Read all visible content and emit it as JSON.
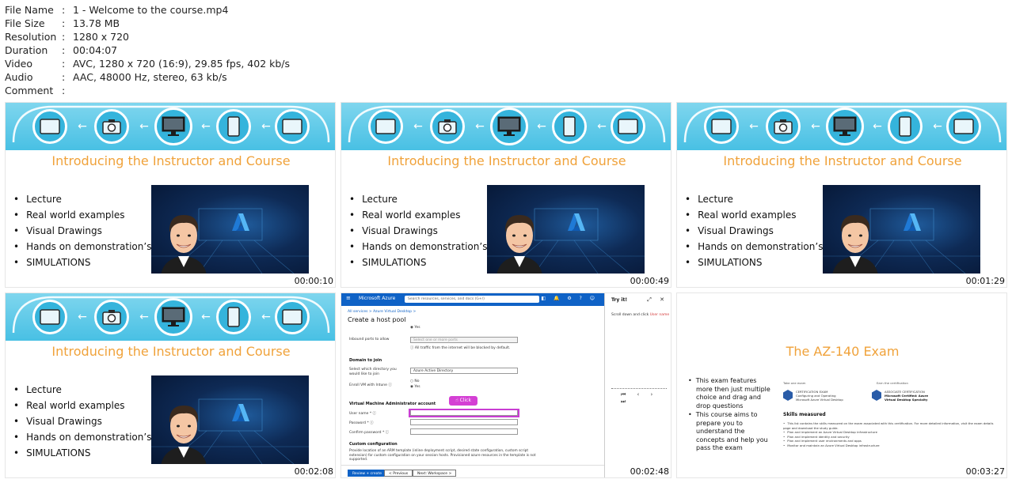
{
  "file_info": {
    "rows": [
      {
        "key": "File Name",
        "value": "1 - Welcome to the course.mp4"
      },
      {
        "key": "File Size",
        "value": "13.78 MB"
      },
      {
        "key": "Resolution",
        "value": "1280 x 720"
      },
      {
        "key": "Duration",
        "value": "00:04:07"
      },
      {
        "key": "Video",
        "value": "AVC, 1280 x 720 (16:9), 29.85 fps, 402 kb/s"
      },
      {
        "key": "Audio",
        "value": "AAC, 48000 Hz, stereo, 63 kb/s"
      },
      {
        "key": "Comment",
        "value": ""
      }
    ],
    "separator": ":"
  },
  "colors": {
    "banner": "#48c0e4",
    "title_orange": "#f0a23a",
    "azure_blue": "#0f62c6",
    "click_magenta": "#d43fd4"
  },
  "slide_intro": {
    "title": "Introducing the Instructor and Course",
    "bullets": [
      "Lecture",
      "Real world examples",
      "Visual Drawings",
      "Hands on demonstration’s",
      "SIMULATIONS"
    ],
    "icons": [
      "tablet-icon",
      "camera-icon",
      "monitor-icon",
      "phone-icon",
      "tablet-icon"
    ]
  },
  "thumbnails": [
    {
      "timestamp": "00:00:10"
    },
    {
      "timestamp": "00:00:49"
    },
    {
      "timestamp": "00:01:29"
    },
    {
      "timestamp": "00:02:08"
    },
    {
      "timestamp": "00:02:48"
    },
    {
      "timestamp": "00:03:27"
    }
  ],
  "azure": {
    "brand": "Microsoft Azure",
    "search_placeholder": "Search resources, services, and docs (G+/)",
    "top_icons": "▣ ◧ 🔔 ⚙ ? ☺",
    "breadcrumb": "All services > Azure Virtual Desktop >",
    "page_title": "Create a host pool",
    "radio_yes": "◉ Yes",
    "inbound_label": "Inbound ports to allow",
    "inbound_value": "Select one or more ports",
    "inbound_note": "ⓘ All traffic from the internet will be blocked by default.",
    "domain_heading": "Domain to join",
    "directory_label": "Select which directory you would like to join",
    "directory_value": "Azure Active Directory",
    "enroll_label": "Enroll VM with Intune ⓘ",
    "enroll_no": "○ No",
    "enroll_yes": "◉ Yes",
    "admin_heading": "Virtual Machine Administrator account",
    "username_label": "User name * ⓘ",
    "password_label": "Password * ⓘ",
    "confirm_label": "Confirm password * ⓘ",
    "custom_heading": "Custom configuration",
    "custom_text": "Provide location of an ARM template (inline deployment script, desired state configuration, custom script extension) for custom configuration on your session hosts. Provisioned azure resources in the template is not supported.",
    "btn_review": "Review + create",
    "btn_previous": "< Previous",
    "btn_next": "Next: Workspace >",
    "click_label": "Click",
    "tryit_title": "Try it!",
    "tryit_icons": "⤢ ✕",
    "tryit_text": "Scroll down and click ",
    "tryit_link": "User name",
    "tryit_nav": "⏮ ‹ › ⏭"
  },
  "exam": {
    "title": "The AZ-140 Exam",
    "bullets": [
      "This exam features more then just multiple choice and drag and drop questions",
      "This course aims to prepare you to understand the concepts and help you pass the exam"
    ],
    "take_label": "Take one exam",
    "earn_label": "Earn the certification",
    "exam_card_l1": "CERTIFICATION EXAM",
    "exam_card_l2": "Configuring and Operating",
    "exam_card_l3": "Microsoft Azure Virtual Desktop",
    "cert_card_l1": "ASSOCIATE CERTIFICATION",
    "cert_card_l2": "Microsoft Certified: Azure",
    "cert_card_l3": "Virtual Desktop Specialty",
    "skills_heading": "Skills measured",
    "skills": [
      "This list contains the skills measured on the exam associated with this certification. For more detailed information, visit the exam details page and download the study guide.",
      "Plan and implement an Azure Virtual Desktop infrastructure",
      "Plan and implement identity and security",
      "Plan and implement user environments and apps",
      "Monitor and maintain an Azure Virtual Desktop infrastructure"
    ]
  }
}
